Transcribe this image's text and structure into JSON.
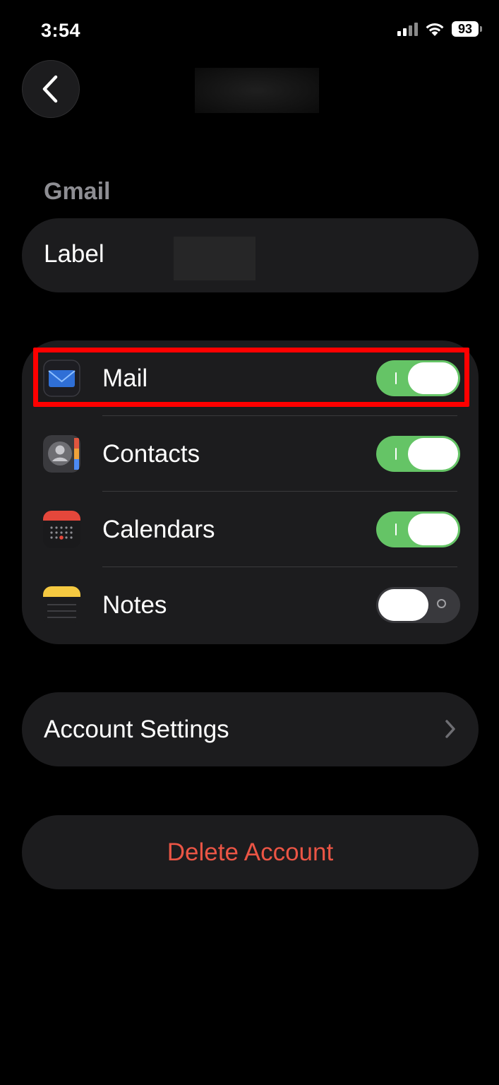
{
  "status_bar": {
    "time": "3:54",
    "battery": "93"
  },
  "nav": {
    "back_icon": "chevron-left-icon"
  },
  "section": {
    "header": "Gmail"
  },
  "label_row": {
    "label": "Label"
  },
  "toggles": [
    {
      "label": "Mail",
      "icon": "mail-icon",
      "enabled": true
    },
    {
      "label": "Contacts",
      "icon": "contacts-icon",
      "enabled": true
    },
    {
      "label": "Calendars",
      "icon": "calendar-icon",
      "enabled": true
    },
    {
      "label": "Notes",
      "icon": "notes-icon",
      "enabled": false
    }
  ],
  "account_settings": {
    "label": "Account Settings",
    "icon": "chevron-right-icon"
  },
  "delete_account": {
    "label": "Delete Account"
  },
  "colors": {
    "toggle_on": "#65c466",
    "toggle_off": "#39393d",
    "destructive": "#eb5545",
    "highlight": "#ff0000",
    "card_bg": "#1c1c1e"
  }
}
